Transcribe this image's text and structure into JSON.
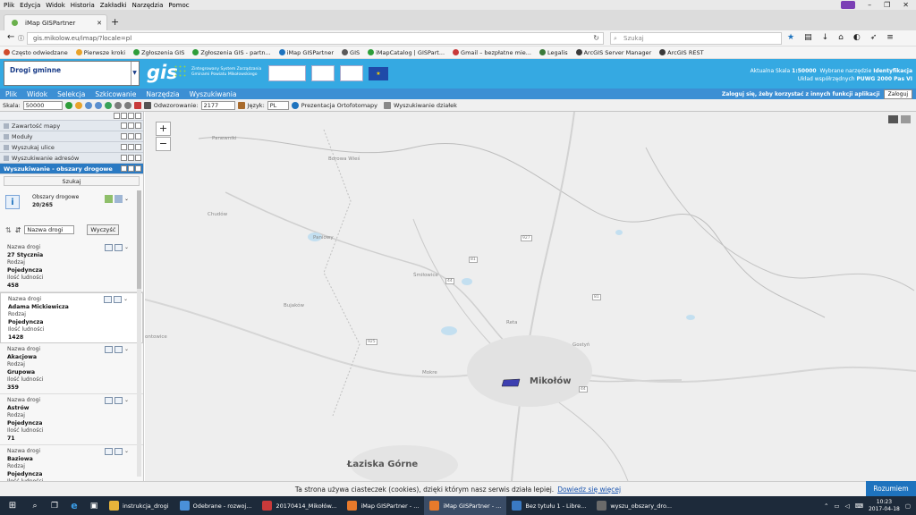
{
  "browser": {
    "menu": [
      "Plik",
      "Edycja",
      "Widok",
      "Historia",
      "Zakładki",
      "Narzędzia",
      "Pomoc"
    ],
    "tab_title": "iMap GISPartner",
    "url": "gis.mikolow.eu/imap/?locale=pl",
    "search_placeholder": "Szukaj",
    "bookmarks": [
      "Często odwiedzane",
      "Pierwsze kroki",
      "Zgłoszenia GIS",
      "Zgłoszenia GIS - partn...",
      "iMap GISPartner",
      "GIS",
      "iMapCatalog | GISPart...",
      "Gmail – bezpłatne mie...",
      "Legalis",
      "ArcGIS Server Manager",
      "ArcGIS REST"
    ]
  },
  "app": {
    "layer_select": "Drogi gminne",
    "logo_text": "gis",
    "logo_sub1": "Zintegrowany System Zarządzania",
    "logo_sub2": "Gminami Powiatu Mikołowskiego",
    "scale_label": "Aktualna Skala",
    "scale_value": "1:50000",
    "tool_label": "Wybrane narzędzie",
    "tool_value": "Identyfikacja",
    "crs_label": "Układ współrzędnych",
    "crs_value": "PUWG 2000 Pas VI",
    "login_hint": "Zaloguj się, żeby korzystać z innych funkcji aplikacji",
    "login_button": "Zaloguj",
    "menu": [
      "Plik",
      "Widok",
      "Selekcja",
      "Szkicowanie",
      "Narzędzia",
      "Wyszukiwania"
    ]
  },
  "toolbar": {
    "scale_label": "Skala:",
    "scale_value": "50000",
    "odwz_label": "Odwzorowanie:",
    "odwz_value": "2177",
    "lang_label": "Język:",
    "lang_value": "PL",
    "ortho_label": "Prezentacja Ortofotomapy",
    "parcel_label": "Wyszukiwanie działek"
  },
  "sidebar": {
    "panels": [
      "Zawartość mapy",
      "Moduły",
      "Wyszukaj ulice",
      "Wyszukiwanie adresów"
    ],
    "active_panel": "Wyszukiwanie - obszary drogowe",
    "search_button": "Szukaj",
    "result_title": "Obszary drogowe",
    "result_count": "20/265",
    "sort_select": "Nazwa drogi",
    "clear_button": "Wyczyść",
    "field_name": "Nazwa drogi",
    "field_kind": "Rodzaj",
    "field_pop": "Ilość ludności",
    "results": [
      {
        "name": "27 Stycznia",
        "kind": "Pojedyncza",
        "pop": "458"
      },
      {
        "name": "Adama Mickiewicza",
        "kind": "Pojedyncza",
        "pop": "1428"
      },
      {
        "name": "Akacjowa",
        "kind": "Grupowa",
        "pop": "359"
      },
      {
        "name": "Astrów",
        "kind": "Pojedyncza",
        "pop": "71"
      },
      {
        "name": "Baziowa",
        "kind": "Pojedyncza",
        "pop": ""
      }
    ]
  },
  "map": {
    "places": [
      {
        "name": "Panewniki",
        "big": false
      },
      {
        "name": "Chudów",
        "big": false
      },
      {
        "name": "Paniowy",
        "big": false
      },
      {
        "name": "Bujaków",
        "big": false
      },
      {
        "name": "ontowice",
        "big": false
      },
      {
        "name": "Śmiłowice",
        "big": false
      },
      {
        "name": "Reta",
        "big": false
      },
      {
        "name": "Mokre",
        "big": false
      },
      {
        "name": "Mikołów",
        "big": true
      },
      {
        "name": "Łaziska Górne",
        "big": true
      },
      {
        "name": "Borowa Wieś",
        "big": false
      },
      {
        "name": "Gostyń",
        "big": false
      }
    ],
    "roads": [
      "44",
      "81",
      "925",
      "44",
      "81",
      "927"
    ]
  },
  "cookie": {
    "text": "Ta strona używa ciasteczek (cookies), dzięki którym nasz serwis działa lepiej.",
    "link": "Dowiedz się więcej",
    "button": "Rozumiem"
  },
  "taskbar": {
    "items": [
      "instrukcja_drogi",
      "Odebrane - rozwoj...",
      "20170414_Mikołów...",
      "iMap GISPartner - ...",
      "iMap GISPartner - ...",
      "Bez tytułu 1 - Libre...",
      "wyszu_obszary_dro..."
    ],
    "time": "10:23",
    "date": "2017-04-18"
  },
  "colors": {
    "banner": "#35a9e2",
    "menu": "#3c8fd4",
    "active_panel": "#2a7ac3",
    "road_highlight": "#3d3fb0"
  }
}
